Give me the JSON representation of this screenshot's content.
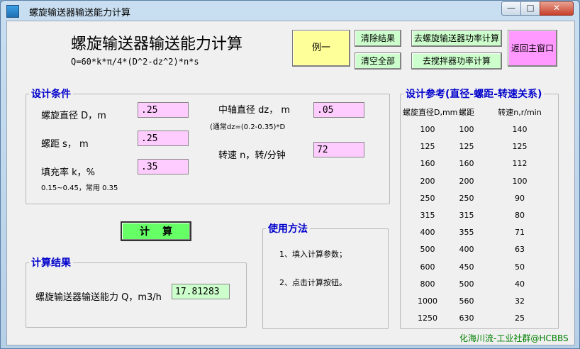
{
  "window": {
    "title": "螺旋输送器输送能力计算",
    "min_glyph": "—",
    "max_glyph": "□",
    "close_glyph": "✕",
    "icon": "app-icon"
  },
  "header": {
    "title": "螺旋输送器输送能力计算",
    "formula": "Q=60*k*π/4*(D^2-dz^2)*n*s"
  },
  "buttons": {
    "example": "例一",
    "clear_results": "清除结果",
    "clear_all": "清空全部",
    "screw_power": "去螺旋输送器功率计算",
    "mixer_power": "去搅拌器功率计算",
    "back_main": "返回主窗口",
    "calculate": "计算"
  },
  "design": {
    "legend": "设计条件",
    "diameter_label": "螺旋直径 D，m",
    "diameter_value": ".25",
    "pitch_label": "螺距 s， m",
    "pitch_value": ".25",
    "fill_label": "填充率 k，%",
    "fill_value": ".35",
    "fill_note": "0.15~0.45，常用 0.35",
    "shaft_label": "中轴直径 dz， m",
    "shaft_value": ".05",
    "shaft_note": "(通常dz=(0.2-0.35)*D",
    "speed_label": "转速 n，转/分钟",
    "speed_value": "72"
  },
  "result": {
    "legend": "计算结果",
    "capacity_label": "螺旋输送器输送能力 Q，m3/h",
    "capacity_value": "17.81283"
  },
  "usage": {
    "legend": "使用方法",
    "step1": "1、填入计算参数；",
    "step2": "2、点击计算按钮。"
  },
  "reference": {
    "legend": "设计参考(直径-螺距-转速关系)",
    "headers": [
      "螺旋直径D,mm",
      "螺距",
      "转速n,r/min"
    ],
    "rows": [
      [
        "100",
        "100",
        "140"
      ],
      [
        "125",
        "125",
        "125"
      ],
      [
        "160",
        "160",
        "112"
      ],
      [
        "200",
        "200",
        "100"
      ],
      [
        "250",
        "250",
        "90"
      ],
      [
        "315",
        "315",
        "80"
      ],
      [
        "400",
        "355",
        "71"
      ],
      [
        "500",
        "400",
        "63"
      ],
      [
        "600",
        "450",
        "50"
      ],
      [
        "800",
        "500",
        "40"
      ],
      [
        "1000",
        "560",
        "32"
      ],
      [
        "1250",
        "630",
        "25"
      ]
    ]
  },
  "footer": {
    "watermark": "化海川流-工业社群@HCBBS"
  }
}
